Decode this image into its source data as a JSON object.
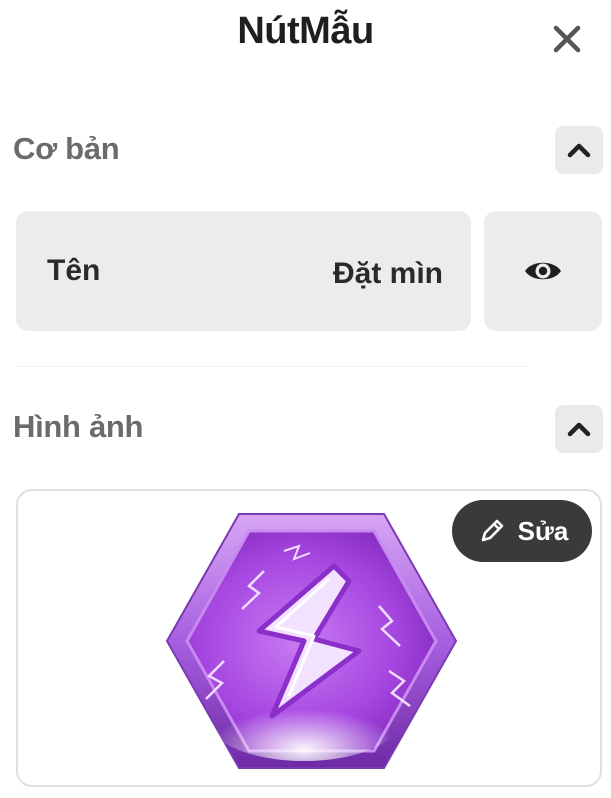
{
  "header": {
    "title": "NútMẫu",
    "close_icon": "close-icon"
  },
  "sections": {
    "basic": {
      "title": "Cơ bản",
      "collapse_icon": "chevron-up-icon",
      "name_field": {
        "label": "Tên",
        "value": "Đặt mìn"
      },
      "visibility_icon": "eye-icon"
    },
    "image": {
      "title": "Hình ảnh",
      "collapse_icon": "chevron-up-icon",
      "preview_icon": "lightning-hexagon-icon",
      "edit_button": {
        "label": "Sửa",
        "icon": "pencil-icon"
      }
    }
  },
  "colors": {
    "panel": "#ececec",
    "section_title": "#6b6b6b",
    "edit_button_bg": "#3a3a3a",
    "icon_purple": "#a64de0"
  }
}
